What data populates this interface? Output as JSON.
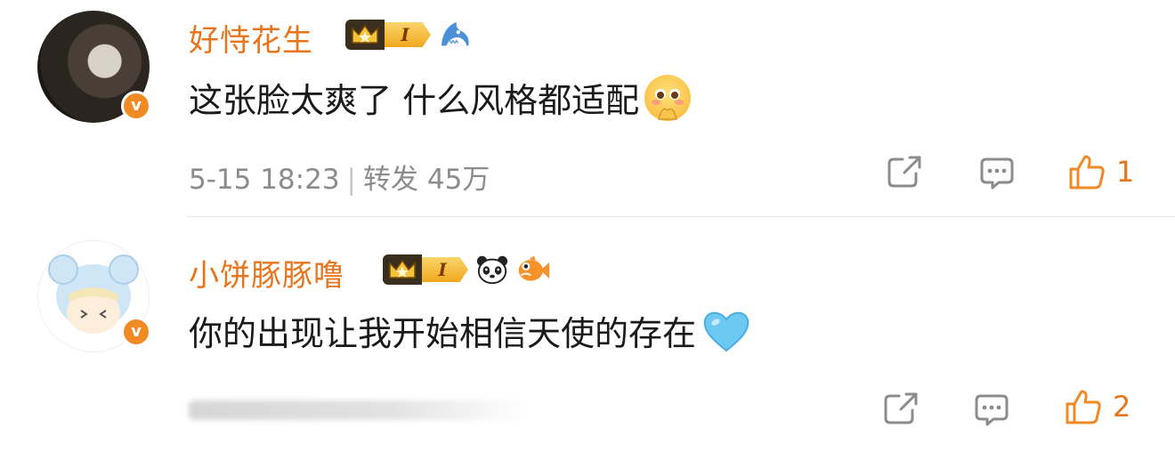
{
  "comments": [
    {
      "username": "好恃花生",
      "level": "I",
      "text": "这张脸太爽了 什么风格都适配",
      "date": "5-15 18:23",
      "separator": "|",
      "repost_label": "转发",
      "repost_count": "45万",
      "likes": "1"
    },
    {
      "username": "小饼豚豚噜",
      "level": "I",
      "text": "你的出现让我开始相信天使的存在",
      "likes": "2"
    }
  ],
  "verified_badge_letter": "v",
  "colors": {
    "username": "#e8741b",
    "meta": "#8c8c8c",
    "like_icon": "#f08a24",
    "verified_badge": "#f08a24",
    "text": "#1a1a1a"
  },
  "icons": {
    "share": "share-icon",
    "comment": "comment-icon",
    "like": "thumbs-up-icon",
    "badge1": "shark-icon",
    "badge2a": "panda-icon",
    "badge2b": "fish-icon"
  }
}
